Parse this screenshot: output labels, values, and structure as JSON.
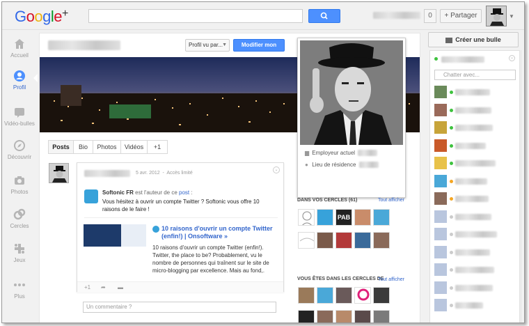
{
  "header": {
    "logo": "Google+",
    "notification_count": "0",
    "share_label": "+ Partager"
  },
  "nav": {
    "items": [
      {
        "label": "Accueil",
        "icon": "home-icon"
      },
      {
        "label": "Profil",
        "icon": "profile-icon"
      },
      {
        "label": "Vidéo-bulles",
        "icon": "hangout-icon"
      },
      {
        "label": "Découvrir",
        "icon": "explore-icon"
      },
      {
        "label": "Photos",
        "icon": "camera-icon"
      },
      {
        "label": "Cercles",
        "icon": "circles-icon"
      },
      {
        "label": "Jeux",
        "icon": "games-icon"
      },
      {
        "label": "Plus",
        "icon": "more-icon"
      }
    ]
  },
  "profile": {
    "view_select": "Profil vu par...",
    "edit_button": "Modifier mon profil",
    "employer_label": "Employeur actuel",
    "residence_label": "Lieu de résidence",
    "tabs": [
      "Posts",
      "Bio",
      "Photos",
      "Vidéos",
      "+1"
    ]
  },
  "post": {
    "date": "5 avr. 2012",
    "visibility": "Accès limité",
    "source_name": "Softonic FR",
    "source_suffix": " est l'auteur de ce ",
    "source_link": "post",
    "source_end": " :",
    "body": "Vous hésitez à ouvrir un compte Twitter ? Softonic vous offre 10 raisons de le faire !",
    "link_title": "10 raisons d'ouvrir un compte Twitter (enfin!) | Onsoftware »",
    "link_desc": "10 raisons d'ouvrir un compte Twitter (enfin!). Twitter, the place to be? Probablement, vu le nombre de personnes qui traînent sur le site de micro-blogging par excellence. Mais au fond,.",
    "plus_one": "+1",
    "comment_placeholder": "Un commentaire ?"
  },
  "circles": {
    "in_circles_title": "DANS VOS CERCLES (61)",
    "in_circles_all": "Tout afficher",
    "their_circles_title": "VOUS ÊTES DANS LES CERCLES DE",
    "their_circles_all": "Tout afficher",
    "pab_label": "PAB"
  },
  "chat": {
    "create_bubble": "Créer une bulle",
    "search_placeholder": "Chatter avec...",
    "status_colors": {
      "online": "#3ec23e",
      "idle": "#f5a623",
      "offline": "#cccccc"
    }
  },
  "colors": {
    "accent_blue": "#4d90fe",
    "link_blue": "#3366cc"
  }
}
